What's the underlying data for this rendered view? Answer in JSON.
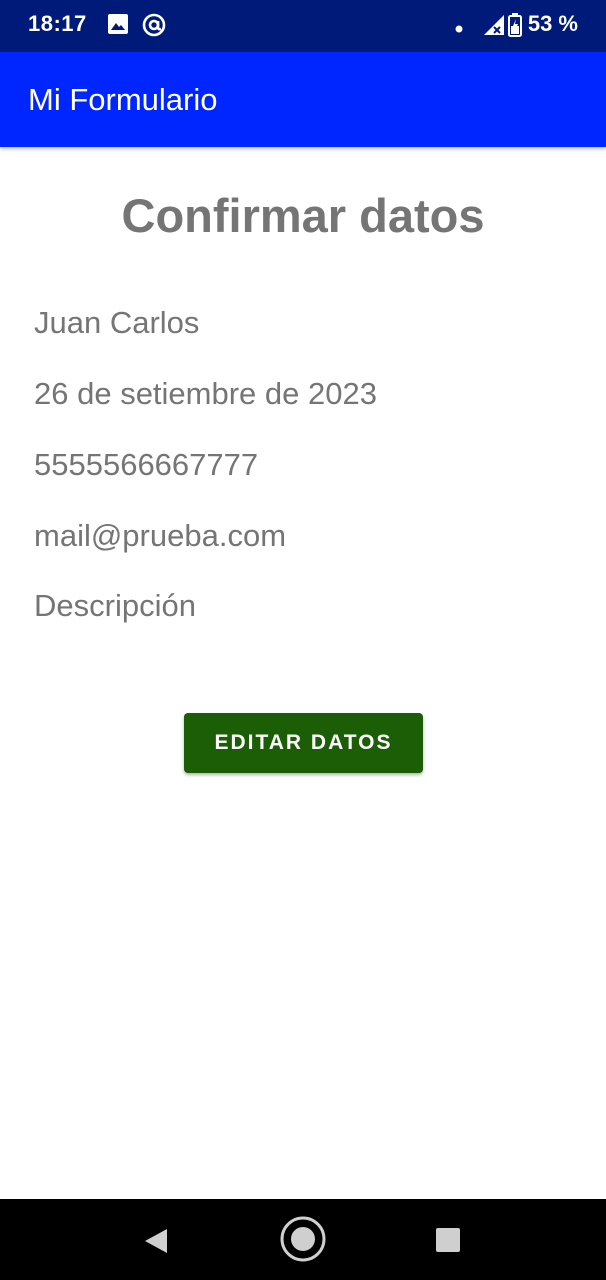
{
  "status_bar": {
    "time": "18:17",
    "battery": "53 %",
    "icons": [
      "image-icon",
      "at-sign-icon",
      "notification-dot-icon",
      "signal-icon",
      "battery-icon"
    ]
  },
  "app_bar": {
    "title": "Mi Formulario"
  },
  "main": {
    "title": "Confirmar datos",
    "fields": {
      "name": "Juan Carlos",
      "date": "26 de setiembre de 2023",
      "phone": "5555566667777",
      "email": "mail@prueba.com",
      "description": "Descripción"
    },
    "edit_button_label": "EDITAR DATOS"
  },
  "navigation_bar": {
    "icons": [
      "back-icon",
      "home-icon",
      "recents-icon"
    ]
  },
  "colors": {
    "status_bar": "#001a7a",
    "app_bar": "#0026ff",
    "button": "#1b5e05",
    "text_gray": "#757575"
  }
}
